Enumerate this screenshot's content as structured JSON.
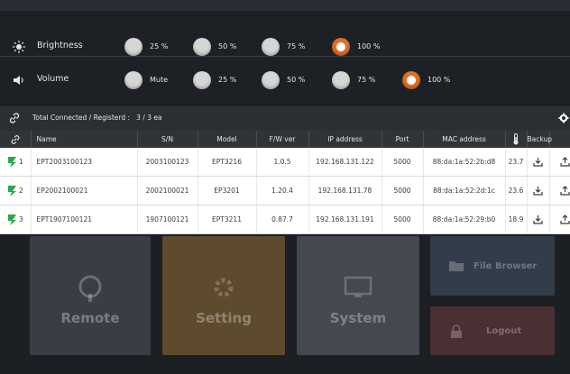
{
  "brightness": {
    "label": "Brightness",
    "options": [
      "25 %",
      "50 %",
      "75 %",
      "100 %"
    ],
    "selected": "100 %"
  },
  "volume": {
    "label": "Volume",
    "options": [
      "Mute",
      "25 %",
      "50 %",
      "75 %",
      "100 %"
    ],
    "selected": "100 %"
  },
  "devices_header": {
    "summary": "Total Connected / Registerd :   3 / 3 ea"
  },
  "table": {
    "columns": [
      "",
      "Name",
      "S/N",
      "Model",
      "F/W ver",
      "IP address",
      "Port",
      "MAC address",
      "",
      "Backup",
      ""
    ],
    "rows": [
      {
        "num": "1",
        "name": "EPT2003100123",
        "sn": "2003100123",
        "model": "EPT3216",
        "fw": "1.0.5",
        "ip": "192.168.131.122",
        "port": "5000",
        "mac": "88:da:1a:52:2b:d8",
        "temp": "23.7"
      },
      {
        "num": "2",
        "name": "EP2002100021",
        "sn": "2002100021",
        "model": "EP3201",
        "fw": "1.20.4",
        "ip": "192.168.131.78",
        "port": "5000",
        "mac": "88:da:1a:52:2d:1c",
        "temp": "23.6"
      },
      {
        "num": "3",
        "name": "EPT1907100121",
        "sn": "1907100121",
        "model": "EPT3211",
        "fw": "0.87.7",
        "ip": "192.168.131.191",
        "port": "5000",
        "mac": "88:da:1a:52:29:b0",
        "temp": "18.9"
      }
    ]
  },
  "tiles": {
    "remote": "Remote",
    "setting": "Setting",
    "system": "System",
    "file_browser": "File Browser",
    "logout": "Logout"
  },
  "colors": {
    "accent": "#e0702a",
    "link_green": "#2aa84a",
    "header_bg": "#2b2e33"
  }
}
